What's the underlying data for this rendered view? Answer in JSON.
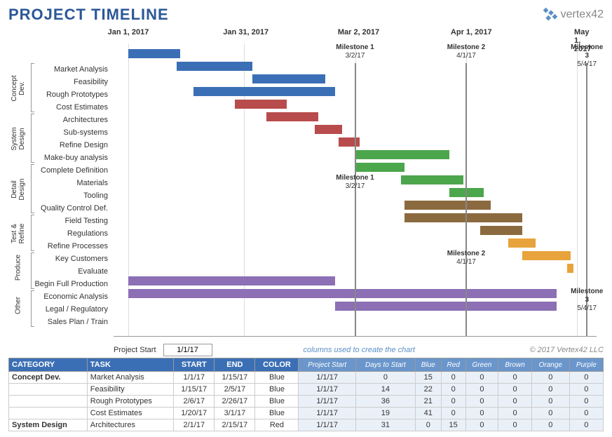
{
  "title": "PROJECT TIMELINE",
  "logo": "vertex42",
  "axis": {
    "start": "Jan 1, 2017",
    "ticks": [
      {
        "label": "Jan 1, 2017",
        "pct": 3
      },
      {
        "label": "Jan 31, 2017",
        "pct": 27
      },
      {
        "label": "Mar 2, 2017",
        "pct": 50
      },
      {
        "label": "Apr 1, 2017",
        "pct": 73
      },
      {
        "label": "May 1, 2017",
        "pct": 96
      }
    ]
  },
  "milestones_top": [
    {
      "name": "Milestone 1",
      "date": "3/2/17",
      "pct": 50
    },
    {
      "name": "Milestone 2",
      "date": "4/1/17",
      "pct": 73
    },
    {
      "name": "Milestone 3",
      "date": "5/4/17",
      "pct": 98
    }
  ],
  "milestones_inline": [
    {
      "name": "Milestone 1",
      "date": "3/2/17",
      "pct": 50,
      "row": 10
    },
    {
      "name": "Milestone 2",
      "date": "4/1/17",
      "pct": 73,
      "row": 16
    },
    {
      "name": "Milestone 3",
      "date": "5/4/17",
      "pct": 98,
      "row": 19
    }
  ],
  "groups": [
    {
      "name": "Concept\nDev.",
      "start": 0,
      "end": 4
    },
    {
      "name": "System\nDesign",
      "start": 4,
      "end": 8
    },
    {
      "name": "Detail\nDesign",
      "start": 8,
      "end": 12
    },
    {
      "name": "Test &\nRefine",
      "start": 12,
      "end": 15
    },
    {
      "name": "Produce",
      "start": 15,
      "end": 18
    },
    {
      "name": "Other",
      "start": 18,
      "end": 21
    }
  ],
  "colors": {
    "Blue": "#3b6fb5",
    "Red": "#b84c4c",
    "Green": "#4ca64c",
    "Brown": "#8c6a3f",
    "Orange": "#e8a33d",
    "Purple": "#8c6fb5"
  },
  "chart_data": {
    "type": "gantt",
    "x_unit": "days_from_start",
    "x_range": [
      0,
      130
    ],
    "tasks": [
      {
        "group": "Concept Dev.",
        "name": "Market Analysis",
        "start": 0,
        "dur": 15,
        "color": "Blue"
      },
      {
        "group": "Concept Dev.",
        "name": "Feasibility",
        "start": 14,
        "dur": 22,
        "color": "Blue"
      },
      {
        "group": "Concept Dev.",
        "name": "Rough Prototypes",
        "start": 36,
        "dur": 21,
        "color": "Blue"
      },
      {
        "group": "Concept Dev.",
        "name": "Cost Estimates",
        "start": 19,
        "dur": 41,
        "color": "Blue"
      },
      {
        "group": "System Design",
        "name": "Architectures",
        "start": 31,
        "dur": 15,
        "color": "Red"
      },
      {
        "group": "System Design",
        "name": "Sub-systems",
        "start": 40,
        "dur": 15,
        "color": "Red"
      },
      {
        "group": "System Design",
        "name": "Refine Design",
        "start": 54,
        "dur": 8,
        "color": "Red"
      },
      {
        "group": "System Design",
        "name": "Make-buy analysis",
        "start": 61,
        "dur": 6,
        "color": "Red"
      },
      {
        "group": "Detail Design",
        "name": "Complete Definition",
        "start": 66,
        "dur": 27,
        "color": "Green"
      },
      {
        "group": "Detail Design",
        "name": "Materials",
        "start": 66,
        "dur": 14,
        "color": "Green"
      },
      {
        "group": "Detail Design",
        "name": "Tooling",
        "start": 79,
        "dur": 18,
        "color": "Green"
      },
      {
        "group": "Detail Design",
        "name": "Quality Control Def.",
        "start": 93,
        "dur": 10,
        "color": "Green"
      },
      {
        "group": "Test & Refine",
        "name": "Field Testing",
        "start": 80,
        "dur": 25,
        "color": "Brown"
      },
      {
        "group": "Test & Refine",
        "name": "Regulations",
        "start": 80,
        "dur": 34,
        "color": "Brown"
      },
      {
        "group": "Test & Refine",
        "name": "Refine Processes",
        "start": 102,
        "dur": 12,
        "color": "Brown"
      },
      {
        "group": "Produce",
        "name": "Key Customers",
        "start": 110,
        "dur": 8,
        "color": "Orange"
      },
      {
        "group": "Produce",
        "name": "Evaluate",
        "start": 114,
        "dur": 14,
        "color": "Orange"
      },
      {
        "group": "Produce",
        "name": "Begin Full Production",
        "start": 127,
        "dur": 2,
        "color": "Orange"
      },
      {
        "group": "Other",
        "name": "Economic Analysis",
        "start": 0,
        "dur": 60,
        "color": "Purple"
      },
      {
        "group": "Other",
        "name": "Legal / Regulatory",
        "start": 0,
        "dur": 124,
        "color": "Purple"
      },
      {
        "group": "Other",
        "name": "Sales Plan / Train",
        "start": 60,
        "dur": 64,
        "color": "Purple"
      }
    ]
  },
  "meta": {
    "project_start_label": "Project Start",
    "project_start_value": "1/1/17",
    "note": "columns used to create the chart",
    "copyright": "© 2017 Vertex42 LLC"
  },
  "table": {
    "headers": [
      "CATEGORY",
      "TASK",
      "START",
      "END",
      "COLOR"
    ],
    "sub_headers": [
      "Project Start",
      "Days to Start",
      "Blue",
      "Red",
      "Green",
      "Brown",
      "Orange",
      "Purple"
    ],
    "rows": [
      {
        "cat": "Concept Dev.",
        "task": "Market Analysis",
        "start": "1/1/17",
        "end": "1/15/17",
        "color": "Blue",
        "ps": "1/1/17",
        "dts": 0,
        "v": [
          15,
          0,
          0,
          0,
          0,
          0
        ]
      },
      {
        "cat": "",
        "task": "Feasibility",
        "start": "1/15/17",
        "end": "2/5/17",
        "color": "Blue",
        "ps": "1/1/17",
        "dts": 14,
        "v": [
          22,
          0,
          0,
          0,
          0,
          0
        ]
      },
      {
        "cat": "",
        "task": "Rough Prototypes",
        "start": "2/6/17",
        "end": "2/26/17",
        "color": "Blue",
        "ps": "1/1/17",
        "dts": 36,
        "v": [
          21,
          0,
          0,
          0,
          0,
          0
        ]
      },
      {
        "cat": "",
        "task": "Cost Estimates",
        "start": "1/20/17",
        "end": "3/1/17",
        "color": "Blue",
        "ps": "1/1/17",
        "dts": 19,
        "v": [
          41,
          0,
          0,
          0,
          0,
          0
        ]
      },
      {
        "cat": "System Design",
        "task": "Architectures",
        "start": "2/1/17",
        "end": "2/15/17",
        "color": "Red",
        "ps": "1/1/17",
        "dts": 31,
        "v": [
          0,
          15,
          0,
          0,
          0,
          0
        ]
      }
    ]
  }
}
